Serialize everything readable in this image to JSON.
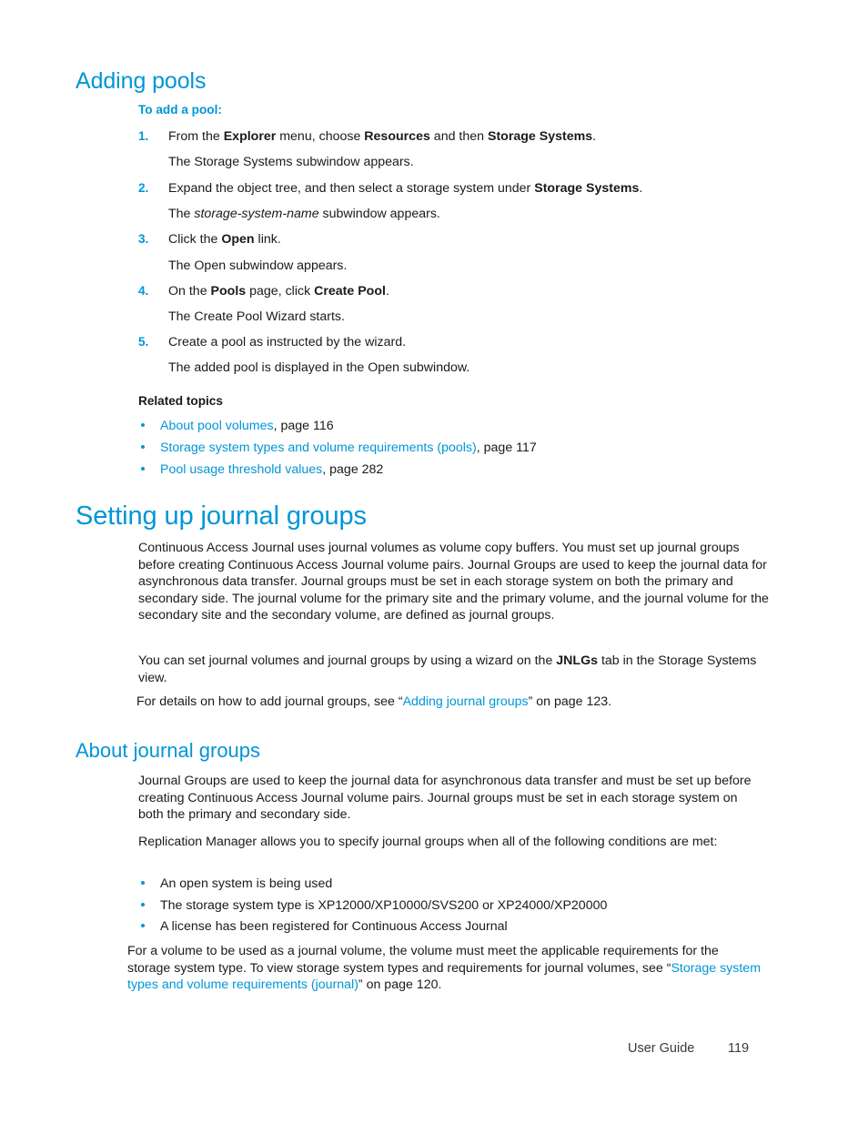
{
  "colors": {
    "heading_blue": "#0096D6",
    "link_blue": "#0096D6",
    "body_text": "#1a1a1a"
  },
  "sections": {
    "adding_pools": {
      "heading": "Adding pools",
      "procedure_label": "To add a pool:",
      "steps": [
        {
          "number": "1.",
          "text_parts": [
            {
              "t": "From the ",
              "style": "normal"
            },
            {
              "t": "Explorer",
              "style": "bold"
            },
            {
              "t": " menu, choose ",
              "style": "normal"
            },
            {
              "t": "Resources",
              "style": "bold"
            },
            {
              "t": " and then ",
              "style": "normal"
            },
            {
              "t": "Storage Systems",
              "style": "bold"
            },
            {
              "t": ".",
              "style": "normal"
            }
          ],
          "result": "The Storage Systems subwindow appears."
        },
        {
          "number": "2.",
          "text_parts": [
            {
              "t": "Expand the object tree, and then select a storage system under ",
              "style": "normal"
            },
            {
              "t": "Storage Systems",
              "style": "bold"
            },
            {
              "t": ".",
              "style": "normal"
            }
          ],
          "result_parts": [
            {
              "t": "The ",
              "style": "normal"
            },
            {
              "t": "storage-system-name",
              "style": "italic"
            },
            {
              "t": " subwindow appears.",
              "style": "normal"
            }
          ]
        },
        {
          "number": "3.",
          "text_parts": [
            {
              "t": "Click the ",
              "style": "normal"
            },
            {
              "t": "Open",
              "style": "bold"
            },
            {
              "t": " link.",
              "style": "normal"
            }
          ],
          "result": "The Open subwindow appears."
        },
        {
          "number": "4.",
          "text_parts": [
            {
              "t": "On the ",
              "style": "normal"
            },
            {
              "t": "Pools",
              "style": "bold"
            },
            {
              "t": " page, click ",
              "style": "normal"
            },
            {
              "t": "Create Pool",
              "style": "bold"
            },
            {
              "t": ".",
              "style": "normal"
            }
          ],
          "result": "The Create Pool Wizard starts."
        },
        {
          "number": "5.",
          "text_parts": [
            {
              "t": "Create a pool as instructed by the wizard.",
              "style": "normal"
            }
          ],
          "result": "The added pool is displayed in the Open subwindow."
        }
      ],
      "related_topics_label": "Related topics",
      "related_topics": [
        {
          "link": "About pool volumes",
          "suffix": ", page 116"
        },
        {
          "link": "Storage system types and volume requirements (pools)",
          "suffix": ", page 117"
        },
        {
          "link": "Pool usage threshold values",
          "suffix": ", page 282"
        }
      ]
    },
    "setting_up_journal_groups": {
      "heading": "Setting up journal groups",
      "paragraph_1": "Continuous Access Journal uses journal volumes as volume copy buffers. You must set up journal groups before creating Continuous Access Journal volume pairs. Journal Groups are used to keep the journal data for asynchronous data transfer. Journal groups must be set in each storage system on both the primary and secondary side. The journal volume for the primary site and the primary volume, and the journal volume for the secondary site and the secondary volume, are defined as journal groups.",
      "paragraph_2_parts": [
        {
          "t": "You can set journal volumes and journal groups by using a wizard on the ",
          "style": "normal"
        },
        {
          "t": "JNLGs",
          "style": "bold"
        },
        {
          "t": " tab in the Storage Systems view.",
          "style": "normal"
        }
      ],
      "paragraph_3_parts": [
        {
          "t": " For details on how to add journal groups, see “",
          "style": "normal"
        },
        {
          "t": "Adding journal groups",
          "style": "link"
        },
        {
          "t": "” on page 123.",
          "style": "normal"
        }
      ]
    },
    "about_journal_groups": {
      "heading": "About journal groups",
      "paragraph_1": "Journal Groups are used to keep the journal data for asynchronous data transfer and must be set up before creating Continuous Access Journal volume pairs. Journal groups must be set in each storage system on both the primary and secondary side.",
      "paragraph_2": "Replication Manager allows you to specify journal groups when all of the following conditions are met:",
      "conditions": [
        "An open system is being used",
        "The storage system type is XP12000/XP10000/SVS200 or XP24000/XP20000",
        "A license has been registered for Continuous Access Journal"
      ],
      "paragraph_3_parts": [
        {
          "t": "For a volume to be used as a journal volume, the volume must meet the applicable requirements for the storage system type. To view storage system types and requirements for journal volumes, see “",
          "style": "normal"
        },
        {
          "t": "Storage system types and volume requirements (journal)",
          "style": "link"
        },
        {
          "t": "” on page 120.",
          "style": "normal"
        }
      ]
    }
  },
  "footer": {
    "guide_label": "User Guide",
    "page_number": "119"
  }
}
